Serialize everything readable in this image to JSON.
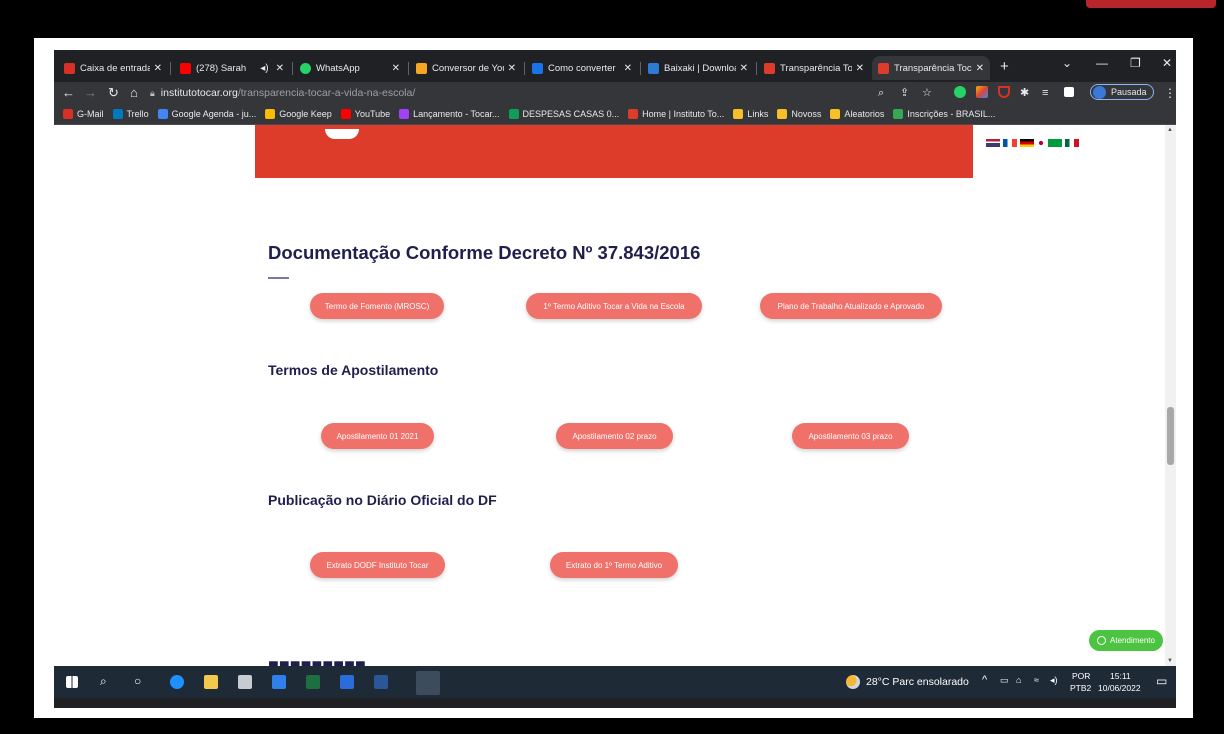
{
  "browser": {
    "tabs": [
      {
        "title": "Caixa de entrada",
        "color": "#d93025"
      },
      {
        "title": "(278) Sarah",
        "color": "#ff0000"
      },
      {
        "title": "WhatsApp",
        "color": "#25d366"
      },
      {
        "title": "Conversor de You",
        "color": "#f5a623"
      },
      {
        "title": "Como converter",
        "color": "#1a73e8"
      },
      {
        "title": "Baixaki | Downloa",
        "color": "#2e7bd6"
      },
      {
        "title": "Transparência Toc",
        "color": "#dd3c2a"
      },
      {
        "title": "Transparência Toc",
        "color": "#dd3c2a"
      }
    ],
    "url_host": "institutotocar.org",
    "url_path": "/transparencia-tocar-a-vida-na-escola/",
    "profile_label": "Pausada",
    "bookmarks": [
      {
        "label": "G-Mail",
        "color": "#d93025"
      },
      {
        "label": "Trello",
        "color": "#0079bf"
      },
      {
        "label": "Google Agenda - ju...",
        "color": "#4285f4"
      },
      {
        "label": "Google Keep",
        "color": "#fbbc04"
      },
      {
        "label": "YouTube",
        "color": "#ff0000"
      },
      {
        "label": "Lançamento - Tocar...",
        "color": "#a142f4"
      },
      {
        "label": "DESPESAS CASAS 0...",
        "color": "#0f9d58"
      },
      {
        "label": "Home | Instituto To...",
        "color": "#dd3c2a"
      },
      {
        "label": "Links",
        "color": "#f6c026"
      },
      {
        "label": "Novoss",
        "color": "#f6c026"
      },
      {
        "label": "Aleatorios",
        "color": "#f6c026"
      },
      {
        "label": "Inscrições - BRASIL...",
        "color": "#34a853"
      }
    ]
  },
  "page": {
    "heading": "Documentação Conforme Decreto Nº 37.843/2016",
    "doc_buttons": [
      "Termo de Fomento (MROSC)",
      "1º Termo Aditivo Tocar a Vida na Escola",
      "Plano de Trabalho Atualizado e Aprovado"
    ],
    "apostilamento_title": "Termos de Apostilamento",
    "apostilamento_buttons": [
      "Apostilamento 01 2021",
      "Apostilamento 02 prazo",
      "Apostilamento 03 prazo"
    ],
    "publicacao_title": "Publicação no Diário Oficial do DF",
    "publicacao_buttons": [
      "Extrato DODF Instituto Tocar",
      "Extrato do 1º Termo Aditivo"
    ],
    "whatsapp_label": "Atendimento"
  },
  "taskbar": {
    "weather": "28°C  Parc ensolarado",
    "lang_top": "POR",
    "lang_bottom": "PTB2",
    "time": "15:11",
    "date": "10/06/2022"
  }
}
